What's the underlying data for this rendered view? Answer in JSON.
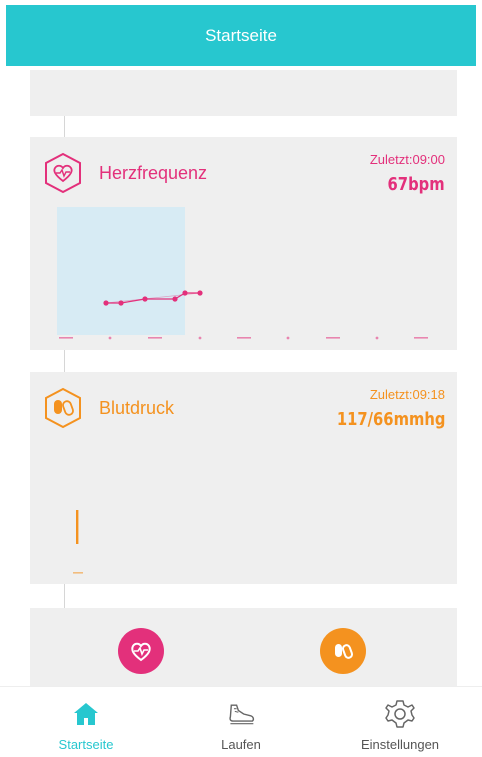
{
  "header": {
    "title": "Startseite"
  },
  "colors": {
    "accent": "#27c7cf",
    "heart": "#e3307b",
    "pressure": "#f4921f"
  },
  "heart_rate": {
    "title": "Herzfrequenz",
    "last_time": "Zuletzt:09:00",
    "last_value": "67bpm",
    "icon": "heart-pulse-icon"
  },
  "blood_pressure": {
    "title": "Blutdruck",
    "last_time": "Zuletzt:09:18",
    "last_value": "117/66mmhg",
    "icon": "pills-icon"
  },
  "tabs": [
    {
      "label": "Startseite",
      "icon": "home-icon",
      "active": true
    },
    {
      "label": "Laufen",
      "icon": "shoe-icon",
      "active": false
    },
    {
      "label": "Einstellungen",
      "icon": "gear-icon",
      "active": false
    }
  ]
}
